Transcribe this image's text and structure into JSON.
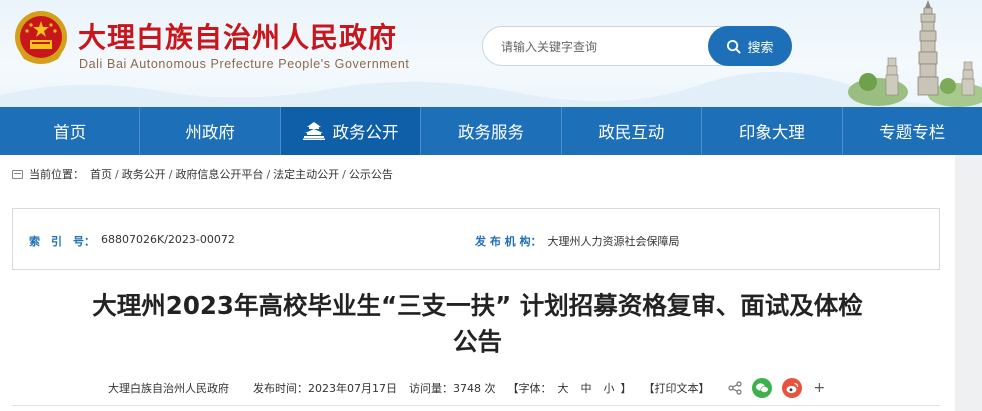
{
  "header": {
    "title_cn": "大理白族自治州人民政府",
    "title_en": "Dali Bai Autonomous Prefecture People's Government",
    "search_placeholder": "请输入关键字查询",
    "search_button": "搜索"
  },
  "nav": {
    "items": [
      {
        "label": "首页"
      },
      {
        "label": "州政府"
      },
      {
        "label": "政务公开"
      },
      {
        "label": "政务服务"
      },
      {
        "label": "政民互动"
      },
      {
        "label": "印象大理"
      },
      {
        "label": "专题专栏"
      }
    ],
    "active_index": 2
  },
  "breadcrumb": {
    "prefix": "当前位置：",
    "items": [
      "首页",
      "政务公开",
      "政府信息公开平台",
      "法定主动公开",
      "公示公告"
    ],
    "separator": "/"
  },
  "info": {
    "index_label": "索　引　号：",
    "index_value": "68807026K/2023-00072",
    "publisher_label": "发 布 机 构：",
    "publisher_value": "大理州人力资源社会保障局"
  },
  "article": {
    "title_line1": "大理州2023年高校毕业生“三支一扶” 计划招募资格复审、面试及体检",
    "title_line2": "公告"
  },
  "meta": {
    "source": "大理白族自治州人民政府",
    "date": "发布时间：2023年07月17日",
    "views": "访问量：3748 次",
    "font_prefix": "【字体：",
    "font_large": "大",
    "font_medium": "中",
    "font_small": "小",
    "font_suffix": "】",
    "print": "【打印文本】",
    "plus": "+"
  },
  "colors": {
    "nav_blue": "#1d6fb8",
    "title_red": "#c8161d",
    "label_blue": "#1d6fb8"
  }
}
